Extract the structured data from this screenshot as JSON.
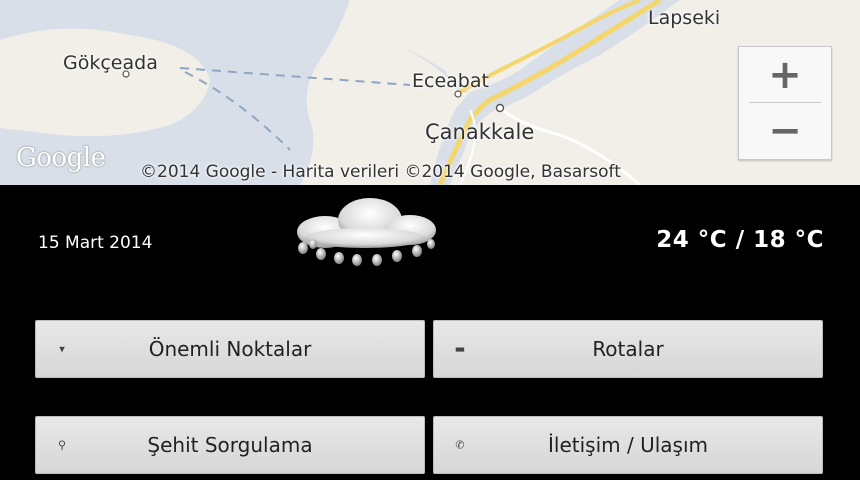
{
  "map": {
    "cities": {
      "gokceada": "Gökçeada",
      "eceabat": "Eceabat",
      "canakkale": "Çanakkale",
      "lapseki": "Lapseki"
    },
    "logo": "Google",
    "attribution": "©2014 Google - Harita verileri ©2014 Google, Basarsoft",
    "zoom_in": "+",
    "zoom_out": "−",
    "colors": {
      "water": "#d8dfe9",
      "land": "#f2efe9",
      "road": "#f5d66b"
    }
  },
  "weather": {
    "date": "15 Mart 2014",
    "temps": "24 °C / 18 °C",
    "icon": "rain-cloud-icon"
  },
  "menu": {
    "noktalar": {
      "label": "Önemli Noktalar",
      "icon": "pin-icon",
      "glyph": "▾"
    },
    "rotalar": {
      "label": "Rotalar",
      "icon": "map-icon",
      "glyph": "▬"
    },
    "sehit": {
      "label": "Şehit Sorgulama",
      "icon": "search-icon",
      "glyph": "⚲"
    },
    "iletisim": {
      "label": "İletişim / Ulaşım",
      "icon": "phone-icon",
      "glyph": "✆"
    }
  }
}
